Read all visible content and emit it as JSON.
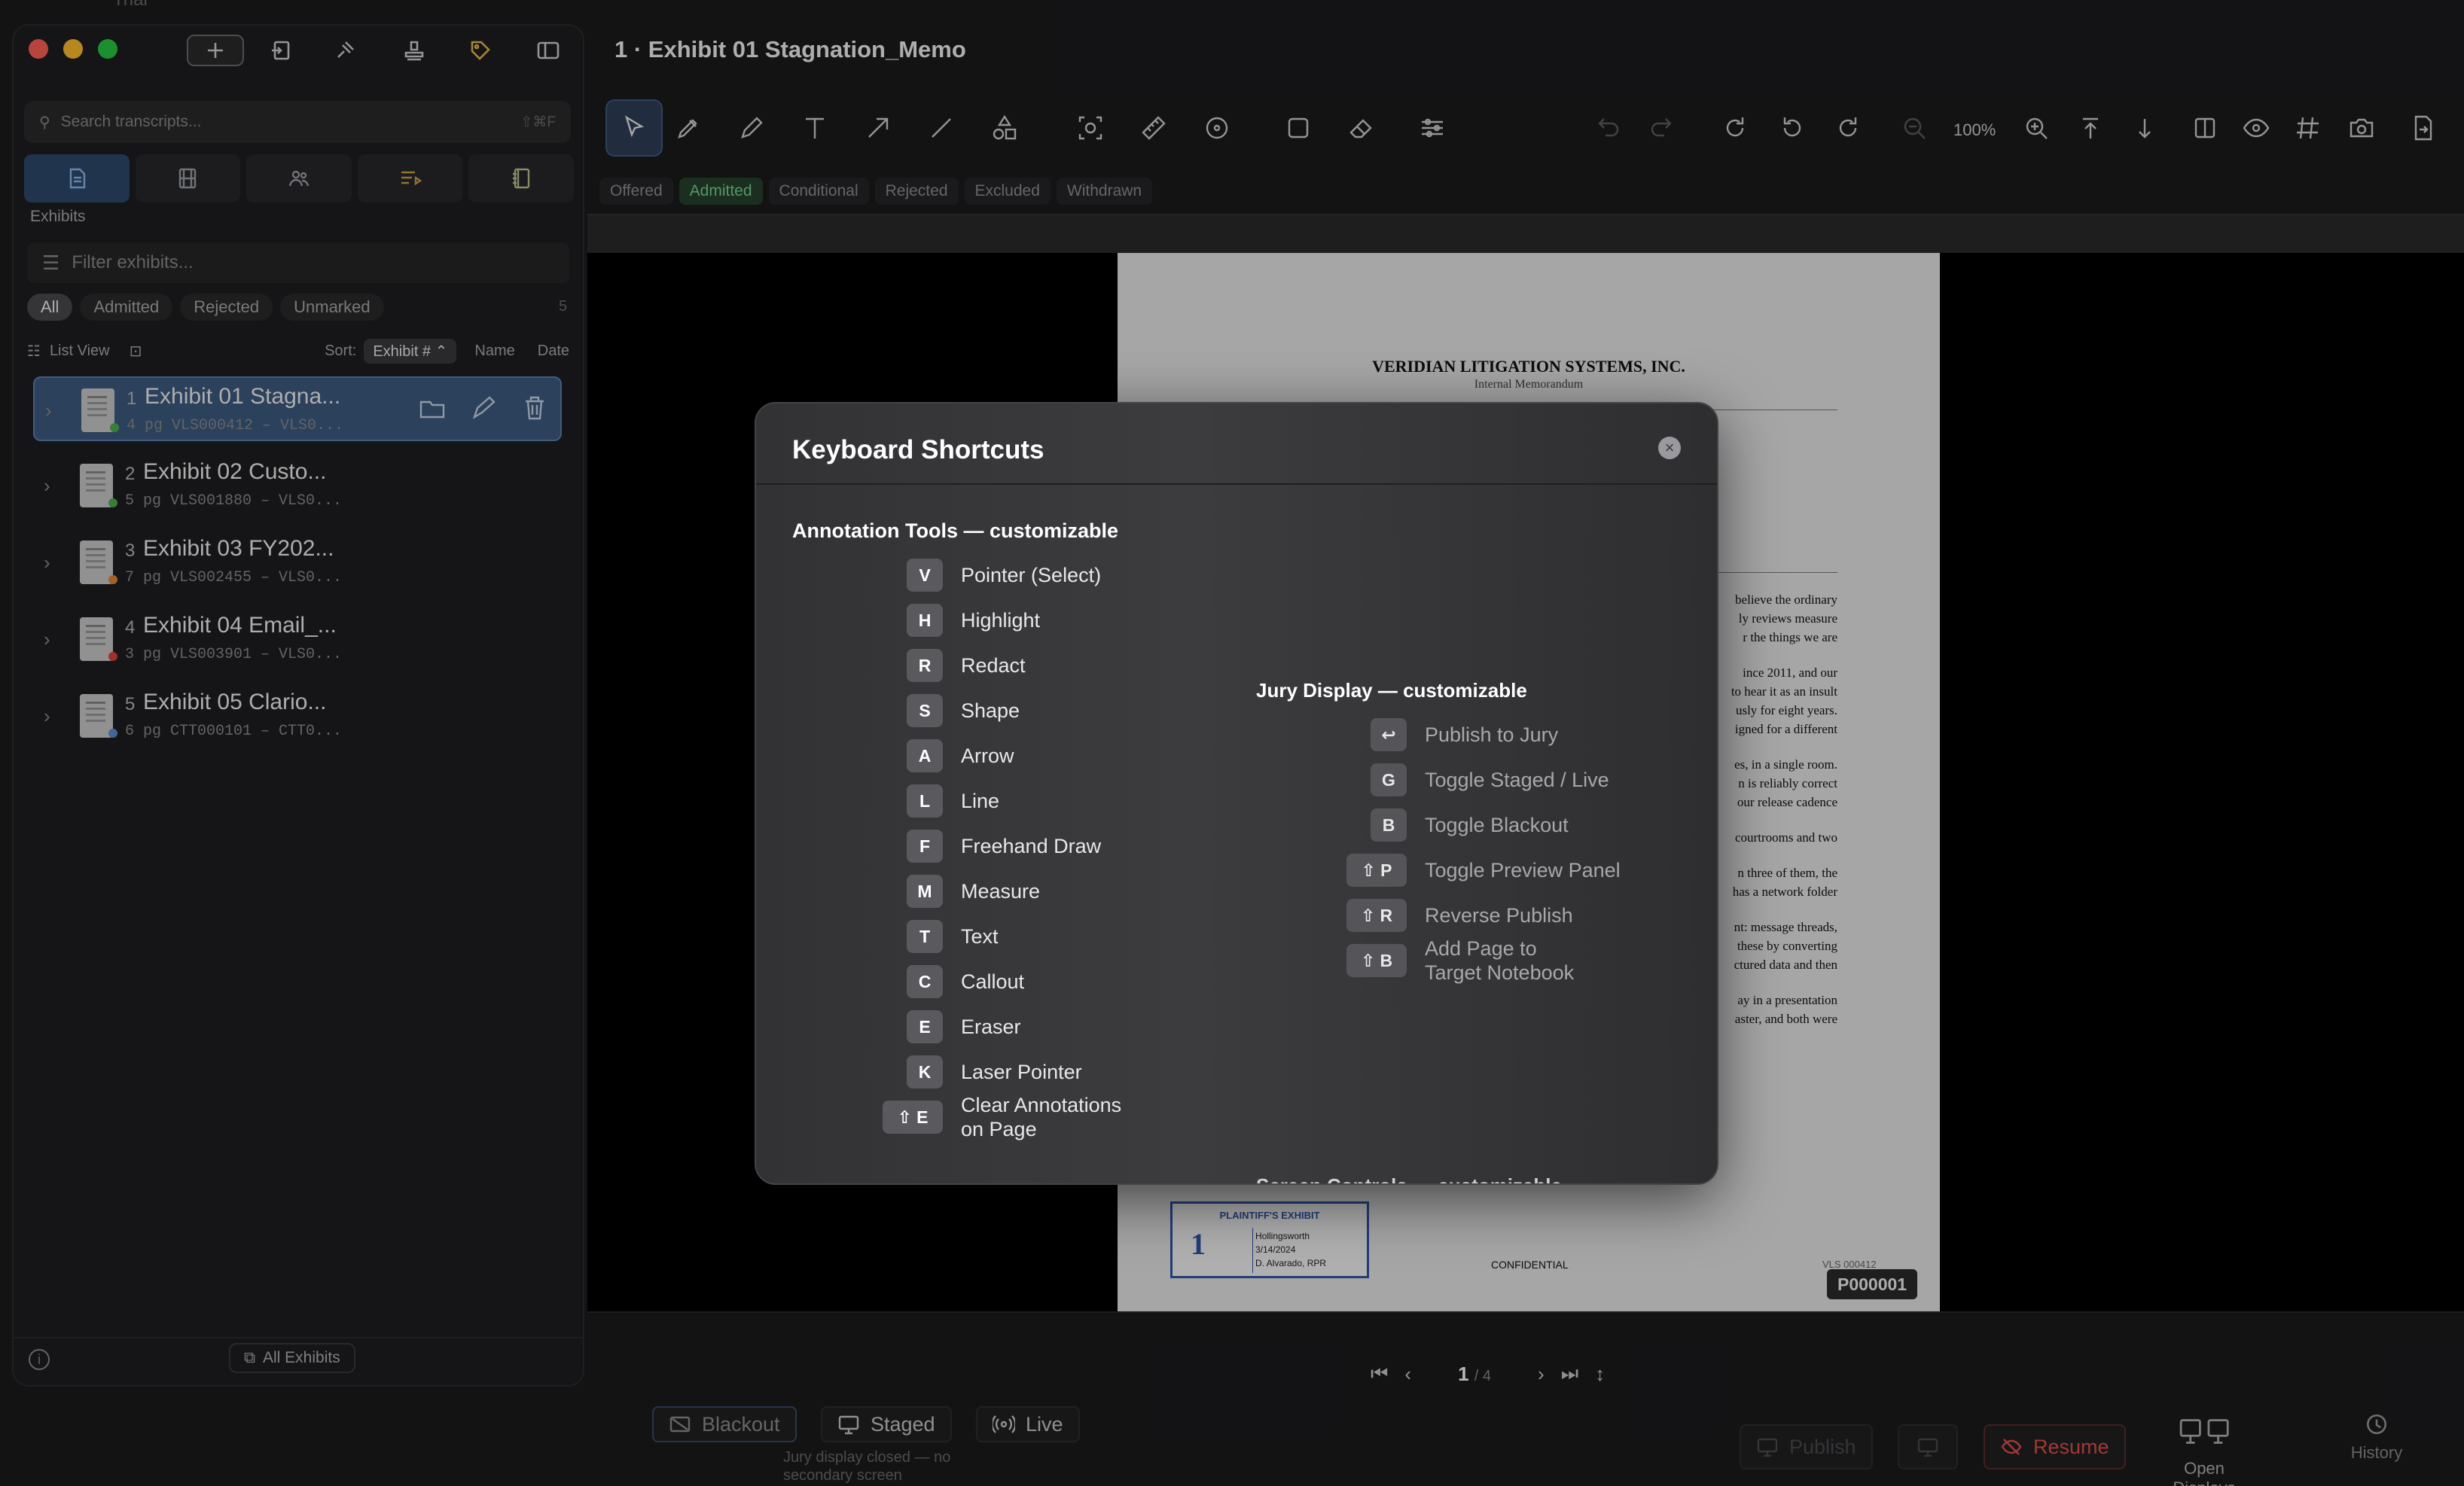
{
  "window": {
    "title": "1 · Exhibit 01 Stagnation_Memo",
    "top_fragment": "Trial"
  },
  "sidebar": {
    "search": {
      "placeholder": "Search transcripts...",
      "shortcut": "⇧⌘F"
    },
    "section_label": "Exhibits",
    "filter_placeholder": "Filter exhibits...",
    "chips": [
      "All",
      "Admitted",
      "Rejected",
      "Unmarked"
    ],
    "count": "5",
    "list_view_label": "List View",
    "sort_label": "Sort:",
    "sort_value": "Exhibit #",
    "sort_options": [
      "Name",
      "Date"
    ],
    "exhibits": [
      {
        "num": "1",
        "title": "Exhibit 01 Stagna...",
        "meta": "4 pg  VLS000412 – VLS0...",
        "dot": "#4caf50"
      },
      {
        "num": "2",
        "title": "Exhibit 02 Custo...",
        "meta": "5 pg  VLS001880 – VLS0...",
        "dot": "#4caf50"
      },
      {
        "num": "3",
        "title": "Exhibit 03 FY202...",
        "meta": "7 pg  VLS002455 – VLS0...",
        "dot": "#e0873a"
      },
      {
        "num": "4",
        "title": "Exhibit 04 Email_...",
        "meta": "3 pg  VLS003901 – VLS0...",
        "dot": "#d9443a"
      },
      {
        "num": "5",
        "title": "Exhibit 05 Clario...",
        "meta": "6 pg  CTT000101 – CTT0...",
        "dot": "#5a8fd0"
      }
    ],
    "footer_button": "All Exhibits"
  },
  "status_tabs": [
    "Offered",
    "Admitted",
    "Conditional",
    "Rejected",
    "Excluded",
    "Withdrawn"
  ],
  "zoom": "100%",
  "document": {
    "company": "VERIDIAN LITIGATION SYSTEMS, INC.",
    "subtitle": "Internal Memorandum",
    "paragraph_fragments": [
      [
        "believe the ordinary",
        "ly reviews measure",
        "r the things we are"
      ],
      [
        "ince 2011, and our",
        "to hear it as an insult",
        "usly for eight years.",
        "igned for a different"
      ],
      [
        "es, in a single room.",
        "n is reliably correct",
        "our release cadence"
      ],
      [
        "courtrooms and two"
      ],
      [
        "n three of them, the",
        "has a network folder"
      ],
      [
        "nt: message threads,",
        "these by converting",
        "ctured data and then"
      ],
      [
        "ay in a presentation",
        "aster, and both were"
      ]
    ],
    "sticker": {
      "heading": "PLAINTIFF'S EXHIBIT",
      "number": "1",
      "lines": [
        "Hollingsworth",
        "3/14/2024",
        "D. Alvarado, RPR"
      ]
    },
    "footer_center": "CONFIDENTIAL",
    "footer_right": "VLS 000412",
    "bates": "P000001"
  },
  "pager": {
    "current": "1",
    "total": "/ 4"
  },
  "bottom": {
    "blackout": "Blackout",
    "staged": "Staged",
    "live": "Live",
    "jury_status": "Jury display closed — no secondary screen",
    "publish": "Publish",
    "resume": "Resume",
    "open_displays": "Open Displays",
    "history": "History"
  },
  "modal": {
    "title": "Keyboard Shortcuts",
    "close_glyph": "×",
    "annotation_title": "Annotation Tools — customizable",
    "annotation": [
      {
        "key": "V",
        "label": "Pointer (Select)"
      },
      {
        "key": "H",
        "label": "Highlight"
      },
      {
        "key": "R",
        "label": "Redact"
      },
      {
        "key": "S",
        "label": "Shape"
      },
      {
        "key": "A",
        "label": "Arrow"
      },
      {
        "key": "L",
        "label": "Line"
      },
      {
        "key": "F",
        "label": "Freehand Draw"
      },
      {
        "key": "M",
        "label": "Measure"
      },
      {
        "key": "T",
        "label": "Text"
      },
      {
        "key": "C",
        "label": "Callout"
      },
      {
        "key": "E",
        "label": "Eraser"
      },
      {
        "key": "K",
        "label": "Laser Pointer"
      },
      {
        "key": "⇧ E",
        "label": "Clear Annotations\non Page"
      }
    ],
    "jury_title": "Jury Display — customizable",
    "jury": [
      {
        "key": "↩",
        "label": "Publish to Jury"
      },
      {
        "key": "G",
        "label": "Toggle Staged / Live"
      },
      {
        "key": "B",
        "label": "Toggle Blackout"
      },
      {
        "key": "⇧ P",
        "label": "Toggle Preview Panel"
      },
      {
        "key": "⇧ R",
        "label": "Reverse Publish"
      },
      {
        "key": "⇧ B",
        "label": "Add Page to\nTarget Notebook"
      }
    ],
    "next_section_fragment": "Screen Controls — customizable"
  },
  "colors": {
    "accent": "#3c5a80",
    "admitted": "#78d08c",
    "resume": "#e0504a"
  }
}
